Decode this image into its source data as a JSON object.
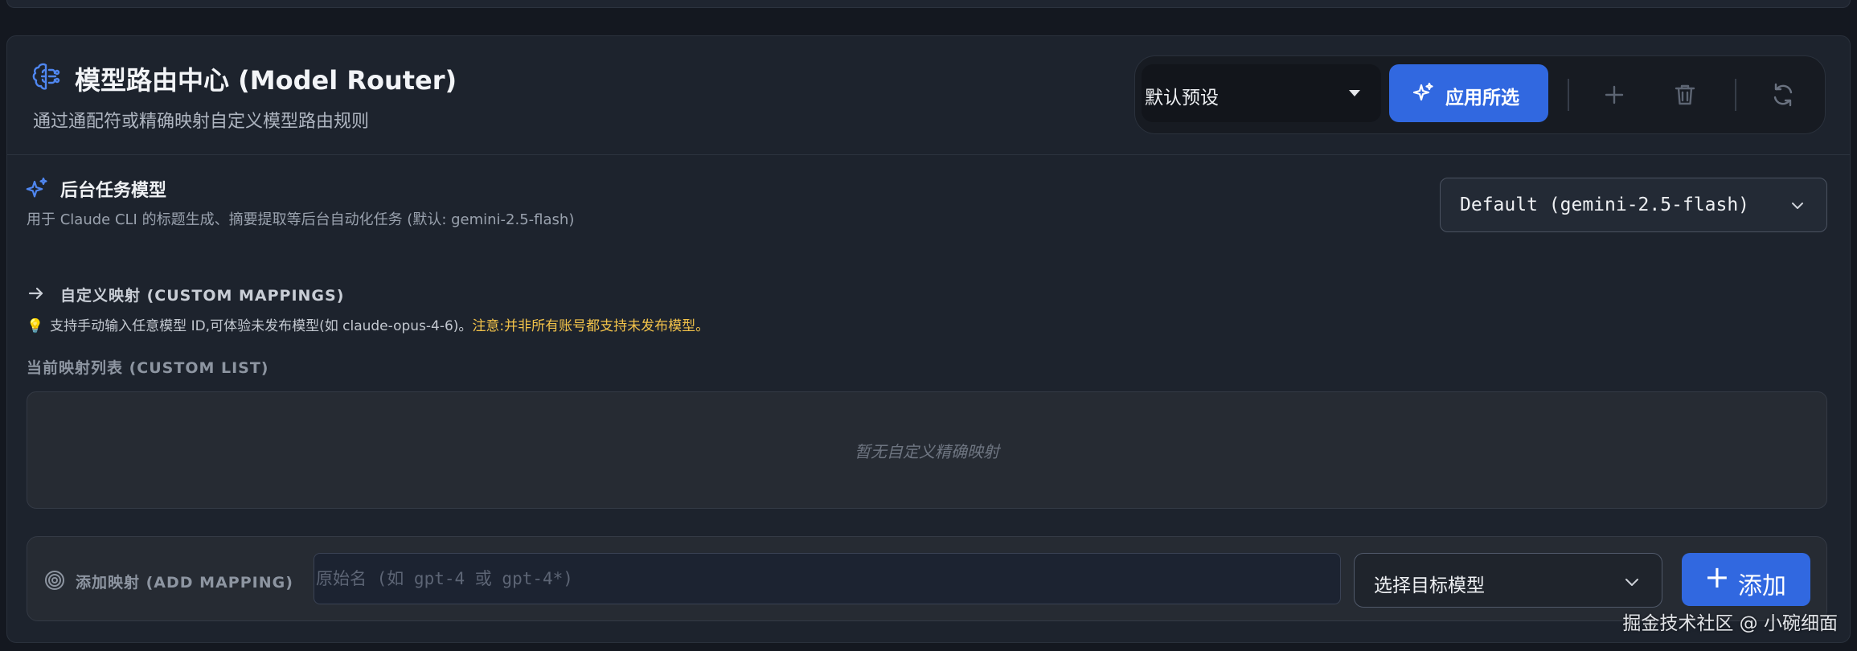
{
  "header": {
    "title": "模型路由中心 (Model Router)",
    "subtitle": "通过通配符或精确映射自定义模型路由规则",
    "icon": "brain-icon"
  },
  "toolbar": {
    "preset_value": "默认预设",
    "apply_label": "应用所选",
    "icons": [
      "plus-icon",
      "trash-icon",
      "refresh-icon"
    ]
  },
  "background_task": {
    "title": "后台任务模型",
    "description": "用于 Claude CLI 的标题生成、摘要提取等后台自动化任务 (默认: gemini-2.5-flash)",
    "selected_model": "Default (gemini-2.5-flash)"
  },
  "custom_mappings": {
    "title": "自定义映射 (CUSTOM MAPPINGS)",
    "tip_text": "支持手动输入任意模型 ID,可体验未发布模型(如 claude-opus-4-6)。",
    "tip_warning": "注意:并非所有账号都支持未发布模型。",
    "list_title": "当前映射列表 (CUSTOM LIST)",
    "empty_text": "暂无自定义精确映射"
  },
  "add_mapping": {
    "label": "添加映射 (ADD MAPPING)",
    "source_placeholder": "原始名 (如 gpt-4 或 gpt-4*)",
    "source_value": "",
    "target_placeholder": "选择目标模型",
    "add_label": "添加"
  },
  "watermark": "掘金技术社区 @ 小碗细面",
  "colors": {
    "accent": "#3168e0",
    "warning": "#f3c34a",
    "card_bg": "#1d232d",
    "page_bg": "#141820"
  }
}
